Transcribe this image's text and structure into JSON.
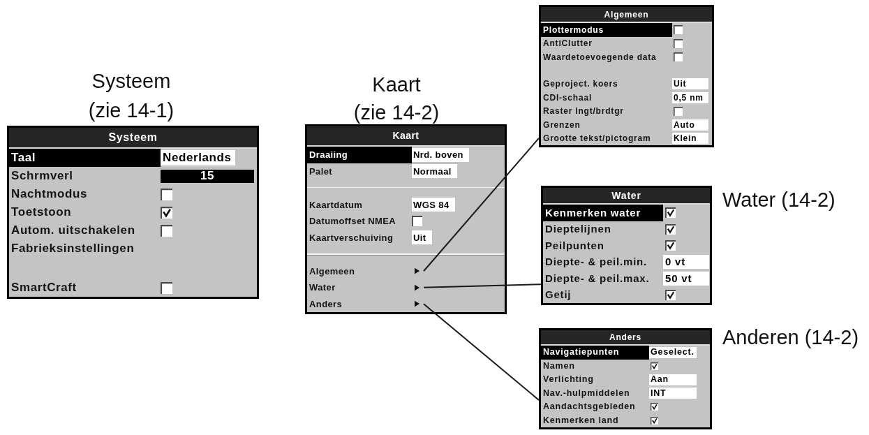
{
  "panels": [
    {
      "caption": [
        "Systeem",
        "(zie 14-1)"
      ],
      "title": "Systeem",
      "groups": [
        [
          {
            "kind": "select",
            "label": "Taal",
            "value": "Nederlands",
            "selected": true
          },
          {
            "kind": "bar",
            "label": "Schrmverl",
            "value": "15",
            "selected": false
          },
          {
            "kind": "checkbox",
            "label": "Nachtmodus",
            "checked": false,
            "selected": false
          },
          {
            "kind": "checkbox",
            "label": "Toetstoon",
            "checked": true,
            "selected": false
          },
          {
            "kind": "checkbox",
            "label": "Autom. uitschakelen",
            "checked": false,
            "selected": false
          },
          {
            "kind": "action",
            "label": "Fabrieksinstellingen",
            "selected": false
          }
        ],
        [
          {
            "kind": "checkbox",
            "label": "SmartCraft",
            "checked": false,
            "selected": false
          }
        ]
      ]
    },
    {
      "caption": [
        "Kaart",
        "(zie 14-2)"
      ],
      "title": "Kaart",
      "groups": [
        [
          {
            "kind": "select",
            "label": "Draaiing",
            "value": "Nrd. boven",
            "selected": true
          },
          {
            "kind": "select",
            "label": "Palet",
            "value": "Normaal",
            "selected": false
          }
        ],
        [
          {
            "kind": "select",
            "label": "Kaartdatum",
            "value": "WGS 84",
            "selected": false
          },
          {
            "kind": "checkbox",
            "label": "Datumoffset NMEA",
            "checked": false,
            "selected": false
          },
          {
            "kind": "select",
            "label": "Kaartverschuiving",
            "value": "Uit",
            "selected": false
          }
        ],
        [
          {
            "kind": "submenu",
            "label": "Algemeen",
            "selected": false
          },
          {
            "kind": "submenu",
            "label": "Water",
            "selected": false
          },
          {
            "kind": "submenu",
            "label": "Anders",
            "selected": false
          }
        ]
      ]
    },
    {
      "title": "Algemeen",
      "groups": [
        [
          {
            "kind": "checkbox",
            "label": "Plottermodus",
            "checked": false,
            "selected": true
          },
          {
            "kind": "checkbox",
            "label": "AntiClutter",
            "checked": false,
            "selected": false
          },
          {
            "kind": "checkbox",
            "label": "Waardetoevoegende data",
            "checked": false,
            "selected": false
          }
        ],
        [
          {
            "kind": "select",
            "label": "Geproject. koers",
            "value": "Uit",
            "selected": false
          },
          {
            "kind": "select",
            "label": "CDI-schaal",
            "value": "0,5 nm",
            "selected": false
          },
          {
            "kind": "checkbox",
            "label": "Raster lngt/brdtgr",
            "checked": false,
            "selected": false
          },
          {
            "kind": "select",
            "label": "Grenzen",
            "value": "Auto",
            "selected": false
          },
          {
            "kind": "select",
            "label": "Grootte tekst/pictogram",
            "value": "Klein",
            "selected": false
          }
        ]
      ]
    },
    {
      "caption": [
        "Water (14-2)"
      ],
      "title": "Water",
      "groups": [
        [
          {
            "kind": "checkbox",
            "label": "Kenmerken water",
            "checked": true,
            "selected": true
          },
          {
            "kind": "checkbox",
            "label": "Dieptelijnen",
            "checked": true,
            "selected": false
          },
          {
            "kind": "checkbox",
            "label": "Peilpunten",
            "checked": true,
            "selected": false
          },
          {
            "kind": "select",
            "label": "Diepte- & peil.min.",
            "value": "0 vt",
            "selected": false
          },
          {
            "kind": "select",
            "label": "Diepte- & peil.max.",
            "value": "50 vt",
            "selected": false
          },
          {
            "kind": "checkbox",
            "label": "Getij",
            "checked": true,
            "selected": false
          }
        ]
      ]
    },
    {
      "caption": [
        "Anderen (14-2)"
      ],
      "title": "Anders",
      "groups": [
        [
          {
            "kind": "select",
            "label": "Navigatiepunten",
            "value": "Geselect.",
            "selected": true
          },
          {
            "kind": "checkbox",
            "label": "Namen",
            "checked": true,
            "selected": false
          },
          {
            "kind": "select",
            "label": "Verlichting",
            "value": "Aan",
            "selected": false
          },
          {
            "kind": "select",
            "label": "Nav.-hulpmiddelen",
            "value": "INT",
            "selected": false
          },
          {
            "kind": "checkbox",
            "label": "Aandachtsgebieden",
            "checked": true,
            "selected": false
          },
          {
            "kind": "checkbox",
            "label": "Kenmerken land",
            "checked": true,
            "selected": false
          }
        ]
      ]
    }
  ]
}
